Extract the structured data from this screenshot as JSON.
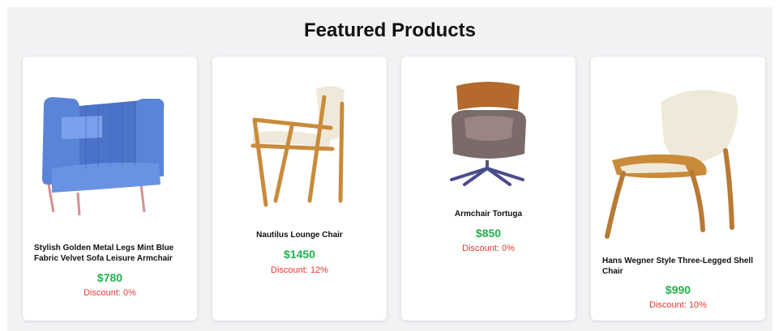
{
  "page": {
    "title": "Featured Products"
  },
  "colors": {
    "price": "#22b14c",
    "discount": "#e53935",
    "background": "#f2f2f5"
  },
  "products": [
    {
      "name": "Stylish Golden Metal Legs Mint Blue Fabric Velvet Sofa Leisure Armchair",
      "price": "$780",
      "discount": "Discount: 0%",
      "image": "blue-velvet-armchair"
    },
    {
      "name": "Nautilus Lounge Chair",
      "price": "$1450",
      "discount": "Discount: 12%",
      "image": "wood-lounge-chair"
    },
    {
      "name": "Armchair Tortuga",
      "price": "$850",
      "discount": "Discount: 0%",
      "image": "swivel-armchair"
    },
    {
      "name": "Hans Wegner Style Three-Legged Shell Chair",
      "price": "$990",
      "discount": "Discount: 10%",
      "image": "shell-chair"
    }
  ]
}
